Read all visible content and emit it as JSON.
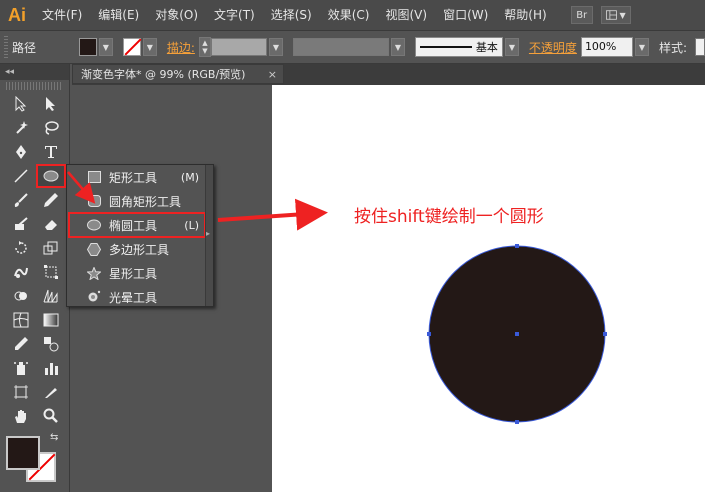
{
  "app": {
    "logo": "Ai"
  },
  "menu": {
    "items": [
      "文件(F)",
      "编辑(E)",
      "对象(O)",
      "文字(T)",
      "选择(S)",
      "效果(C)",
      "视图(V)",
      "窗口(W)",
      "帮助(H)"
    ],
    "bridge_label": "Br",
    "workspace_icon": "grid-icon"
  },
  "control": {
    "selection_label": "路径",
    "stroke_label": "描边:",
    "stroke_style_label": "基本",
    "opacity_label": "不透明度",
    "opacity_value": "100%",
    "style_label": "样式:"
  },
  "document": {
    "tab_title": "渐变色字体* @ 99% (RGB/预览)",
    "close_glyph": "×"
  },
  "toolbar": {
    "collapse_glyph": "◂◂",
    "swap_glyph": "⇆"
  },
  "flyout": {
    "items": [
      {
        "label": "矩形工具",
        "shortcut": "(M)"
      },
      {
        "label": "圆角矩形工具",
        "shortcut": ""
      },
      {
        "label": "椭圆工具",
        "shortcut": "(L)"
      },
      {
        "label": "多边形工具",
        "shortcut": ""
      },
      {
        "label": "星形工具",
        "shortcut": ""
      },
      {
        "label": "光晕工具",
        "shortcut": ""
      }
    ]
  },
  "annotation": {
    "text": "按住shift键绘制一个圆形"
  },
  "colors": {
    "accent": "#ee2222",
    "fill": "#231816",
    "selection": "#3a5ad9",
    "logo": "#f2a02a"
  }
}
